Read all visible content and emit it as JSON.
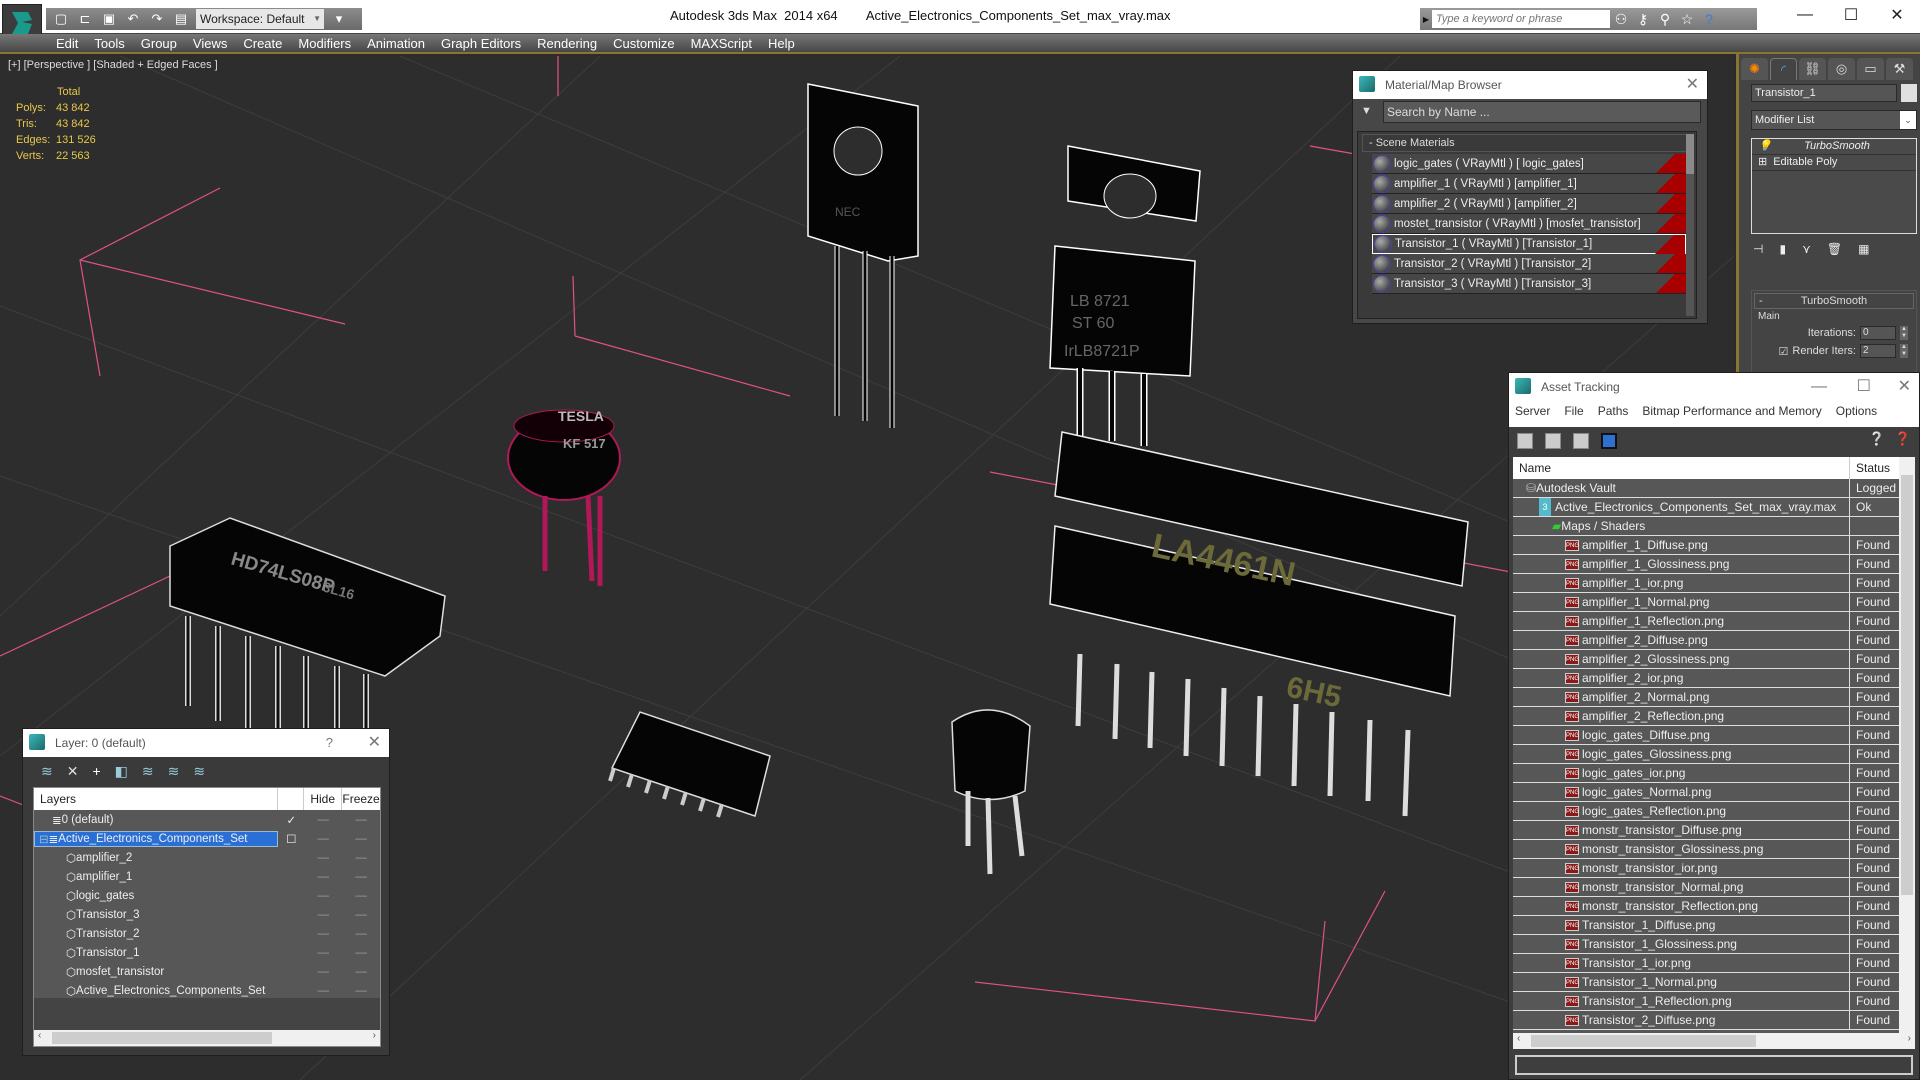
{
  "app": {
    "title": "Autodesk 3ds Max  2014 x64",
    "file": "Active_Electronics_Components_Set_max_vray.max",
    "workspace": "Workspace: Default",
    "search_placeholder": "Type a keyword or phrase"
  },
  "menu": [
    "Edit",
    "Tools",
    "Group",
    "Views",
    "Create",
    "Modifiers",
    "Animation",
    "Graph Editors",
    "Rendering",
    "Customize",
    "MAXScript",
    "Help"
  ],
  "viewport": {
    "label": "[+] [Perspective ] [Shaded + Edged Faces ]",
    "stats": {
      "header": "Total",
      "rows": [
        {
          "k": "Polys:",
          "v": "43 842"
        },
        {
          "k": "Tris:",
          "v": "43 842"
        },
        {
          "k": "Edges:",
          "v": "131 526"
        },
        {
          "k": "Verts:",
          "v": "22 563"
        }
      ]
    },
    "chip_labels": {
      "tesla": "TESLA",
      "kf": "KF 517",
      "hd": "HD74LS08P",
      "hd2": "3L16",
      "la": "LA4461N",
      "la2": "6H5",
      "lb": "LB 8721",
      "lb2": "ST   60",
      "lb3": "IrLB8721P",
      "nec": "NEC"
    }
  },
  "material_browser": {
    "title": "Material/Map Browser",
    "search_placeholder": "Search by Name ...",
    "section": "- Scene Materials",
    "materials": [
      " logic_gates  ( VRayMtl ) [ logic_gates]",
      "amplifier_1  ( VRayMtl ) [amplifier_1]",
      "amplifier_2  ( VRayMtl ) [amplifier_2]",
      "mostet_transistor ( VRayMtl ) [mosfet_transistor]",
      "Transistor_1  ( VRayMtl ) [Transistor_1]",
      "Transistor_2  ( VRayMtl ) [Transistor_2]",
      "Transistor_3  ( VRayMtl ) [Transistor_3]"
    ],
    "selected_index": 4
  },
  "command_panel": {
    "object_name": "Transistor_1",
    "modifier_list": "Modifier List",
    "stack": [
      "TurboSmooth",
      "Editable Poly"
    ],
    "rollout": "TurboSmooth",
    "group": "Main",
    "iterations_label": "Iterations:",
    "iterations": "0",
    "render_iters_label": "Render Iters:",
    "render_iters": "2",
    "render_iters_checked": true
  },
  "asset_tracking": {
    "title": "Asset Tracking",
    "menu": [
      "Server",
      "File",
      "Paths",
      "Bitmap Performance and Memory",
      "Options"
    ],
    "columns": [
      "Name",
      "Status"
    ],
    "rows": [
      {
        "name": "Autodesk Vault",
        "status": "Logged",
        "indent": 1,
        "icon": "vault"
      },
      {
        "name": "Active_Electronics_Components_Set_max_vray.max",
        "status": "Ok",
        "indent": 2,
        "icon": "max"
      },
      {
        "name": "Maps / Shaders",
        "status": "",
        "indent": 3,
        "icon": "maps"
      },
      {
        "name": "amplifier_1_Diffuse.png",
        "status": "Found",
        "indent": 4,
        "icon": "png"
      },
      {
        "name": "amplifier_1_Glossiness.png",
        "status": "Found",
        "indent": 4,
        "icon": "png"
      },
      {
        "name": "amplifier_1_ior.png",
        "status": "Found",
        "indent": 4,
        "icon": "png"
      },
      {
        "name": "amplifier_1_Normal.png",
        "status": "Found",
        "indent": 4,
        "icon": "png"
      },
      {
        "name": "amplifier_1_Reflection.png",
        "status": "Found",
        "indent": 4,
        "icon": "png"
      },
      {
        "name": "amplifier_2_Diffuse.png",
        "status": "Found",
        "indent": 4,
        "icon": "png"
      },
      {
        "name": "amplifier_2_Glossiness.png",
        "status": "Found",
        "indent": 4,
        "icon": "png"
      },
      {
        "name": "amplifier_2_ior.png",
        "status": "Found",
        "indent": 4,
        "icon": "png"
      },
      {
        "name": "amplifier_2_Normal.png",
        "status": "Found",
        "indent": 4,
        "icon": "png"
      },
      {
        "name": "amplifier_2_Reflection.png",
        "status": "Found",
        "indent": 4,
        "icon": "png"
      },
      {
        "name": "logic_gates_Diffuse.png",
        "status": "Found",
        "indent": 4,
        "icon": "png"
      },
      {
        "name": "logic_gates_Glossiness.png",
        "status": "Found",
        "indent": 4,
        "icon": "png"
      },
      {
        "name": "logic_gates_ior.png",
        "status": "Found",
        "indent": 4,
        "icon": "png"
      },
      {
        "name": "logic_gates_Normal.png",
        "status": "Found",
        "indent": 4,
        "icon": "png"
      },
      {
        "name": "logic_gates_Reflection.png",
        "status": "Found",
        "indent": 4,
        "icon": "png"
      },
      {
        "name": "monstr_transistor_Diffuse.png",
        "status": "Found",
        "indent": 4,
        "icon": "png"
      },
      {
        "name": "monstr_transistor_Glossiness.png",
        "status": "Found",
        "indent": 4,
        "icon": "png"
      },
      {
        "name": "monstr_transistor_ior.png",
        "status": "Found",
        "indent": 4,
        "icon": "png"
      },
      {
        "name": "monstr_transistor_Normal.png",
        "status": "Found",
        "indent": 4,
        "icon": "png"
      },
      {
        "name": "monstr_transistor_Reflection.png",
        "status": "Found",
        "indent": 4,
        "icon": "png"
      },
      {
        "name": "Transistor_1_Diffuse.png",
        "status": "Found",
        "indent": 4,
        "icon": "png"
      },
      {
        "name": "Transistor_1_Glossiness.png",
        "status": "Found",
        "indent": 4,
        "icon": "png"
      },
      {
        "name": "Transistor_1_ior.png",
        "status": "Found",
        "indent": 4,
        "icon": "png"
      },
      {
        "name": "Transistor_1_Normal.png",
        "status": "Found",
        "indent": 4,
        "icon": "png"
      },
      {
        "name": "Transistor_1_Reflection.png",
        "status": "Found",
        "indent": 4,
        "icon": "png"
      },
      {
        "name": "Transistor_2_Diffuse.png",
        "status": "Found",
        "indent": 4,
        "icon": "png"
      }
    ]
  },
  "layer_manager": {
    "title": "Layer: 0 (default)",
    "help": "?",
    "columns": [
      "Layers",
      "",
      "Hide",
      "Freeze"
    ],
    "rows": [
      {
        "name": "0 (default)",
        "type": "layer",
        "indent": 1,
        "current": true
      },
      {
        "name": "Active_Electronics_Components_Set",
        "type": "layer",
        "indent": 0,
        "selected": true,
        "expand": "⊟"
      },
      {
        "name": "amplifier_2",
        "type": "object",
        "indent": 2
      },
      {
        "name": "amplifier_1",
        "type": "object",
        "indent": 2
      },
      {
        "name": " logic_gates",
        "type": "object",
        "indent": 2
      },
      {
        "name": "Transistor_3",
        "type": "object",
        "indent": 2
      },
      {
        "name": "Transistor_2",
        "type": "object",
        "indent": 2
      },
      {
        "name": "Transistor_1",
        "type": "object",
        "indent": 2
      },
      {
        "name": "mosfet_transistor",
        "type": "object",
        "indent": 2
      },
      {
        "name": "Active_Electronics_Components_Set",
        "type": "object",
        "indent": 2
      }
    ]
  },
  "colors": {
    "accent_gold": "#8a7530",
    "stats_yellow": "#e6c84a",
    "selection_blue": "#2a6fd6",
    "material_flag_red": "#a80000",
    "wire_pink": "#e0508a",
    "wire_magenta": "#b01858"
  }
}
